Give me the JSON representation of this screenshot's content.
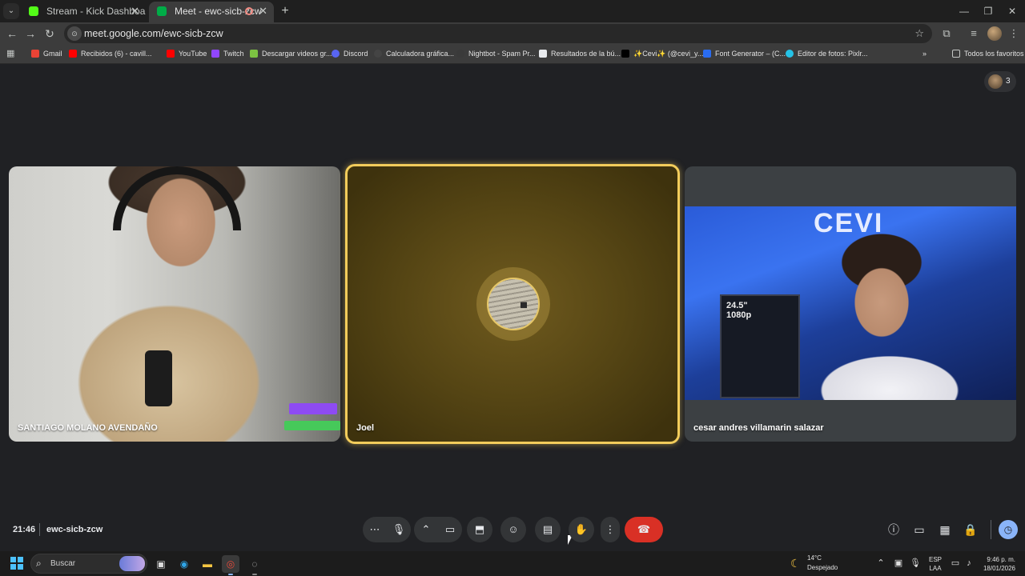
{
  "browser": {
    "tabs": [
      {
        "title": "Stream - Kick Dashboard",
        "favicon_color": "#53fc18"
      },
      {
        "title": "Meet - ewc-sicb-zcw",
        "favicon_color": "#00ac47"
      }
    ],
    "url": "meet.google.com/ewc-sicb-zcw",
    "bookmarks": [
      {
        "label": "Gmail",
        "color": "#ea4335"
      },
      {
        "label": "Recibidos (6) - cavill...",
        "color": "#ff0000"
      },
      {
        "label": "YouTube",
        "color": "#ff0000"
      },
      {
        "label": "Twitch",
        "color": "#9146ff"
      },
      {
        "label": "Descargar videos gr...",
        "color": "#7cc242"
      },
      {
        "label": "Discord",
        "color": "#5865f2"
      },
      {
        "label": "Calculadora gráfica...",
        "color": "#444444"
      },
      {
        "label": "Nightbot - Spam Pr...",
        "color": "#3a3a3a"
      },
      {
        "label": "Resultados de la bú...",
        "color": "#e8eaed"
      },
      {
        "label": "✨Cevi✨ (@cevi_y...",
        "color": "#000000"
      },
      {
        "label": "Font Generator – (C...",
        "color": "#2a6cf0"
      },
      {
        "label": "Editor de fotos: Pixlr...",
        "color": "#25c2e6"
      }
    ],
    "all_bookmarks_label": "Todos los favoritos"
  },
  "meet": {
    "participant_count": "3",
    "tiles": [
      {
        "name": "SANTIAGO MOLANO AVENDAÑO"
      },
      {
        "name": "Joel"
      },
      {
        "name": "cesar andres villamarin salazar"
      }
    ],
    "right_video_sign": "CEVI",
    "right_video_box_text": "24.5\"\n1080p",
    "time": "21:46",
    "meeting_code": "ewc-sicb-zcw",
    "accent_color": "#f2cc5b",
    "end_call_color": "#d93025"
  },
  "taskbar": {
    "search_placeholder": "Buscar",
    "weather_temp": "14°C",
    "weather_desc": "Despejado",
    "lang_line1": "ESP",
    "lang_line2": "LAA",
    "clock_time": "9:46 p. m.",
    "clock_date": "18/01/2026"
  }
}
